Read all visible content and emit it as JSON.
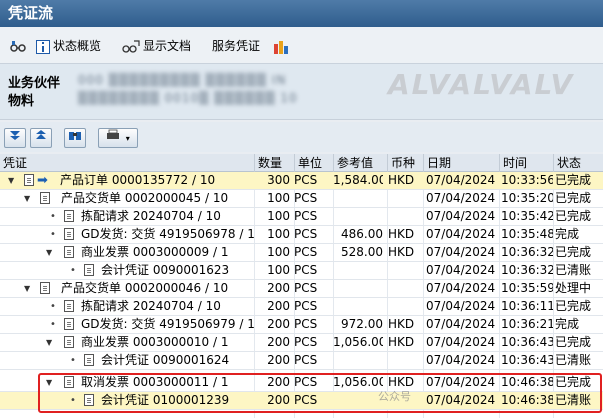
{
  "window": {
    "title": "凭证流"
  },
  "toolbar": {
    "status_overview": "状态概览",
    "display_document": "显示文档",
    "service_document": "服务凭证"
  },
  "header": {
    "partner_label": "业务伙伴",
    "material_label": "物料",
    "partner_value": "000 ▒▒▒▒▒▒▒▒▒ ▒▒▒▒▒▒ IN",
    "material_value": "▒▒▒▒▒▒▒▒ 0010▒ ▒▒▒▒▒▒ 10",
    "watermark": "ALVALVALV"
  },
  "table": {
    "headers": {
      "doc": "凭证",
      "qty": "数量",
      "unit": "单位",
      "ref": "参考值",
      "cur": "币种",
      "date": "日期",
      "time": "时间",
      "status": "状态"
    },
    "rows": [
      {
        "text": "产品订单 0000135772 / 10",
        "qty": "300",
        "unit": "PCS",
        "ref": "1,584.00",
        "cur": "HKD",
        "date": "07/04/2024",
        "time": "10:33:56",
        "status": "已完成"
      },
      {
        "text": "产品交货单 0002000045 / 10",
        "qty": "100",
        "unit": "PCS",
        "ref": "",
        "cur": "",
        "date": "07/04/2024",
        "time": "10:35:20",
        "status": "已完成"
      },
      {
        "text": "拣配请求 20240704 / 10",
        "qty": "100",
        "unit": "PCS",
        "ref": "",
        "cur": "",
        "date": "07/04/2024",
        "time": "10:35:42",
        "status": "已完成"
      },
      {
        "text": "GD发货: 交货 4919506978 / 1",
        "qty": "100",
        "unit": "PCS",
        "ref": "486.00",
        "cur": "HKD",
        "date": "07/04/2024",
        "time": "10:35:48",
        "status": "完成"
      },
      {
        "text": "商业发票 0003000009 / 1",
        "qty": "100",
        "unit": "PCS",
        "ref": "528.00",
        "cur": "HKD",
        "date": "07/04/2024",
        "time": "10:36:32",
        "status": "已完成"
      },
      {
        "text": "会计凭证 0090001623",
        "qty": "100",
        "unit": "PCS",
        "ref": "",
        "cur": "",
        "date": "07/04/2024",
        "time": "10:36:32",
        "status": "已清账"
      },
      {
        "text": "产品交货单 0002000046 / 10",
        "qty": "200",
        "unit": "PCS",
        "ref": "",
        "cur": "",
        "date": "07/04/2024",
        "time": "10:35:59",
        "status": "处理中"
      },
      {
        "text": "拣配请求 20240704 / 10",
        "qty": "200",
        "unit": "PCS",
        "ref": "",
        "cur": "",
        "date": "07/04/2024",
        "time": "10:36:11",
        "status": "已完成"
      },
      {
        "text": "GD发货: 交货 4919506979 / 1",
        "qty": "200",
        "unit": "PCS",
        "ref": "972.00",
        "cur": "HKD",
        "date": "07/04/2024",
        "time": "10:36:21",
        "status": "完成"
      },
      {
        "text": "商业发票 0003000010 / 1",
        "qty": "200",
        "unit": "PCS",
        "ref": "1,056.00",
        "cur": "HKD",
        "date": "07/04/2024",
        "time": "10:36:43",
        "status": "已完成"
      },
      {
        "text": "会计凭证 0090001624",
        "qty": "200",
        "unit": "PCS",
        "ref": "",
        "cur": "",
        "date": "07/04/2024",
        "time": "10:36:43",
        "status": "已清账"
      },
      {
        "text": "取消发票 0003000011 / 1",
        "qty": "200",
        "unit": "PCS",
        "ref": "1,056.00",
        "cur": "HKD",
        "date": "07/04/2024",
        "time": "10:46:38",
        "status": "已完成"
      },
      {
        "text": "会计凭证 0100001239",
        "qty": "200",
        "unit": "PCS",
        "ref": "",
        "cur": "",
        "date": "07/04/2024",
        "time": "10:46:38",
        "status": "已清账"
      }
    ]
  },
  "footer_watermark": "公众号",
  "colors": {
    "highlight_row": "#fdf6c4",
    "title_bar": "#3a6898",
    "annotation_box": "#e02020"
  }
}
